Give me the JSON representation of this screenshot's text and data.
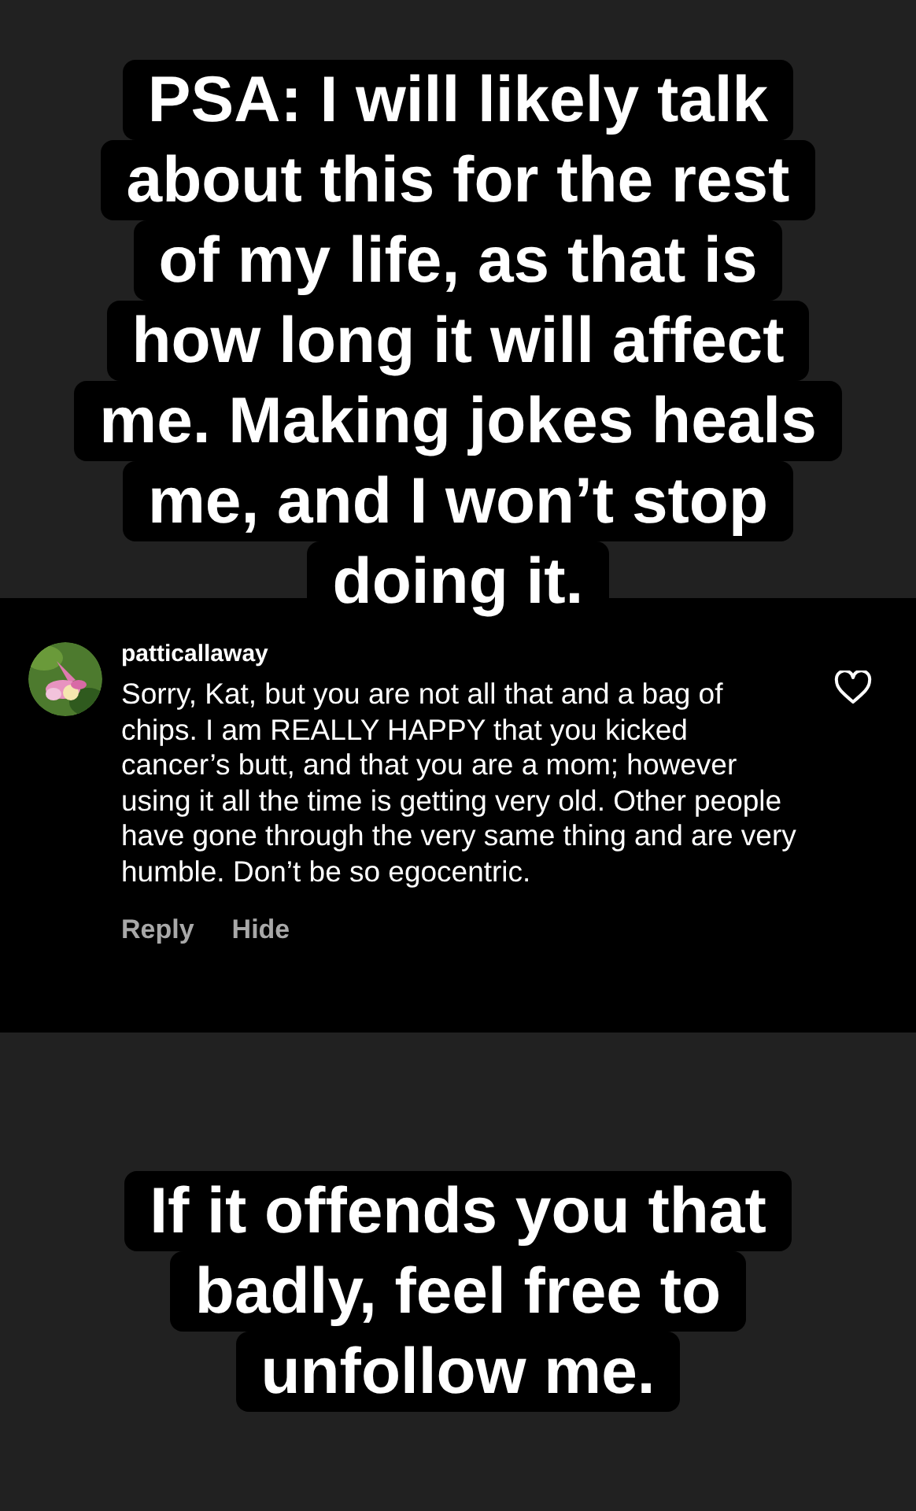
{
  "top_caption": {
    "lines": [
      "PSA: I will likely talk",
      "about this for the rest",
      "of my life, as that is",
      "how long it will affect",
      "me. Making jokes heals",
      "me, and I won’t stop",
      "doing it."
    ]
  },
  "comment": {
    "username": "patticallaway",
    "text": "Sorry, Kat, but you are not all that and a bag of chips. I am REALLY HAPPY that you kicked cancer’s butt, and that you are a mom; however using it all the time is getting very old. Other people have gone through the very same thing and are very humble. Don’t be so egocentric.",
    "liked": false,
    "actions": [
      "Reply",
      "Hide"
    ]
  },
  "bottom_caption": {
    "lines": [
      "If it offends you that",
      "badly, feel free to",
      "unfollow me."
    ]
  }
}
